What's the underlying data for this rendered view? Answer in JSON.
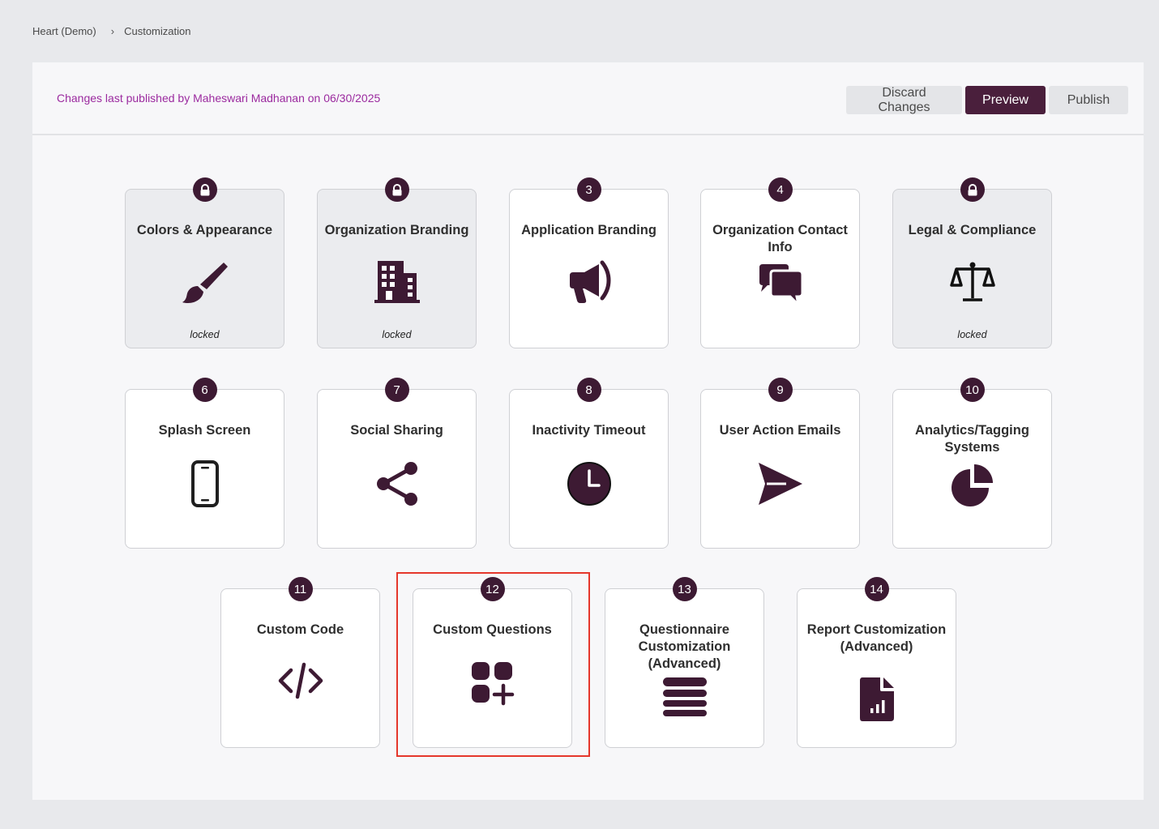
{
  "breadcrumb": {
    "root": "Heart (Demo)",
    "current": "Customization"
  },
  "header": {
    "publish_note": "Changes last published by Maheswari Madhanan on 06/30/2025",
    "discard_label": "Discard Changes",
    "preview_label": "Preview",
    "publish_label": "Publish"
  },
  "cards": [
    {
      "badge": "",
      "badge_icon": "lock-icon",
      "title": "Colors & Appearance",
      "icon": "paintbrush-icon",
      "status": "locked",
      "locked": true
    },
    {
      "badge": "",
      "badge_icon": "lock-icon",
      "title": "Organization Branding",
      "icon": "building-icon",
      "status": "locked",
      "locked": true
    },
    {
      "badge": "3",
      "title": "Application Branding",
      "icon": "megaphone-icon",
      "status": "",
      "locked": false
    },
    {
      "badge": "4",
      "title": "Organization Contact Info",
      "icon": "chat-bubbles-icon",
      "status": "",
      "locked": false
    },
    {
      "badge": "",
      "badge_icon": "lock-icon",
      "title": "Legal & Compliance",
      "icon": "scales-icon",
      "status": "locked",
      "locked": true
    },
    {
      "badge": "6",
      "title": "Splash Screen",
      "icon": "mobile-phone-icon",
      "status": "",
      "locked": false
    },
    {
      "badge": "7",
      "title": "Social Sharing",
      "icon": "share-icon",
      "status": "",
      "locked": false
    },
    {
      "badge": "8",
      "title": "Inactivity Timeout",
      "icon": "clock-icon",
      "status": "",
      "locked": false
    },
    {
      "badge": "9",
      "title": "User Action Emails",
      "icon": "paper-plane-icon",
      "status": "",
      "locked": false
    },
    {
      "badge": "10",
      "title": "Analytics/Tagging Systems",
      "icon": "pie-chart-icon",
      "status": "",
      "locked": false
    },
    {
      "badge": "11",
      "title": "Custom Code",
      "icon": "code-icon",
      "status": "",
      "locked": false
    },
    {
      "badge": "12",
      "title": "Custom Questions",
      "icon": "add-widget-icon",
      "status": "",
      "locked": false
    },
    {
      "badge": "13",
      "title": "Questionnaire Customization (Advanced)",
      "icon": "bars-icon",
      "status": "",
      "locked": false
    },
    {
      "badge": "14",
      "title": "Report Customization (Advanced)",
      "icon": "report-file-icon",
      "status": "",
      "locked": false
    }
  ],
  "colors": {
    "accent_dark": "#3d1a33",
    "button_primary": "#4a1f3c",
    "publish_note": "#9b2a9f",
    "highlight": "#e5372c"
  }
}
